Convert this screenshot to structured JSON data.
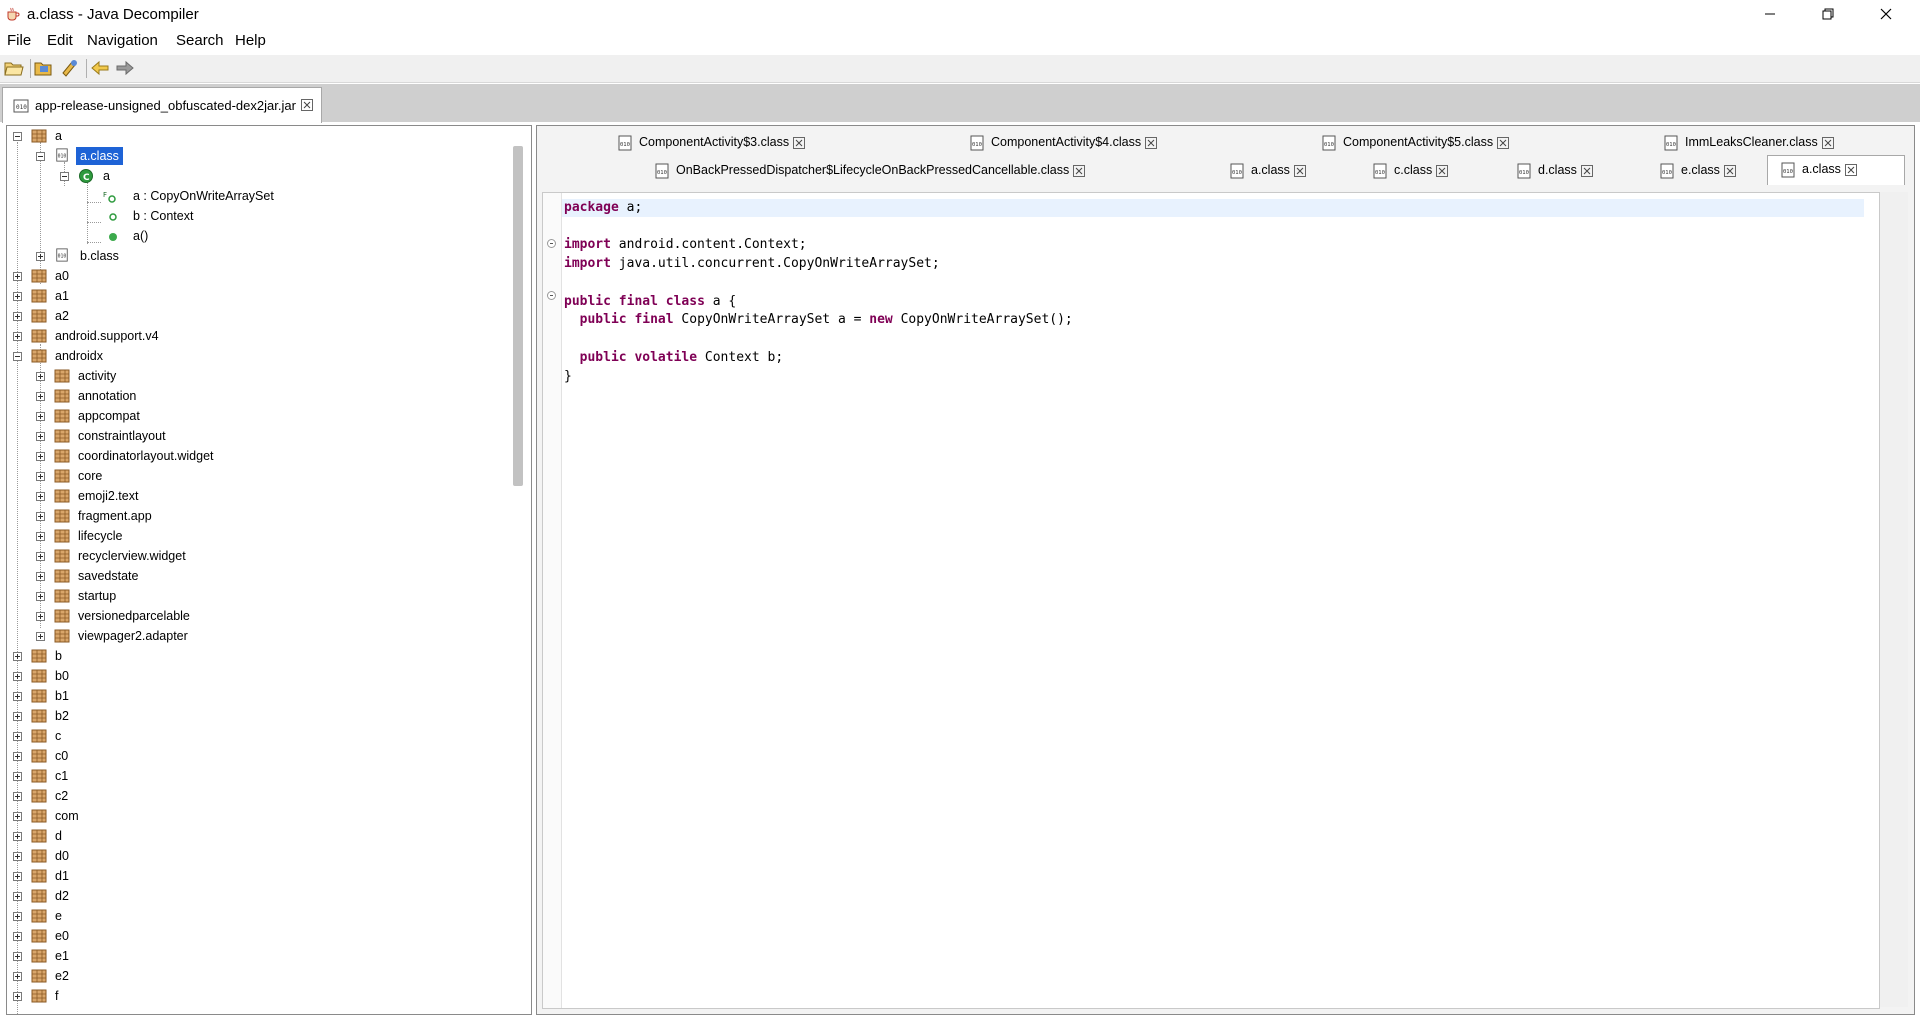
{
  "window": {
    "title": "a.class - Java Decompiler"
  },
  "menu": [
    "File",
    "Edit",
    "Navigation",
    "Search",
    "Help"
  ],
  "toolbar": {
    "icons": [
      "open-file-icon",
      "open-folder-icon",
      "search-type-icon",
      "back-arrow-icon",
      "forward-arrow-icon"
    ]
  },
  "file_tab": {
    "label": "app-release-unsigned_obfuscated-dex2jar.jar"
  },
  "tree": {
    "root_a": "a",
    "a_class": "a.class",
    "class_a": "a",
    "field_a": "a : CopyOnWriteArraySet",
    "field_b": "b : Context",
    "method_a": "a()",
    "b_class": "b.class",
    "packages_top": [
      "a0",
      "a1",
      "a2",
      "android.support.v4",
      "androidx"
    ],
    "androidx_children": [
      "activity",
      "annotation",
      "appcompat",
      "constraintlayout",
      "coordinatorlayout.widget",
      "core",
      "emoji2.text",
      "fragment.app",
      "lifecycle",
      "recyclerview.widget",
      "savedstate",
      "startup",
      "versionedparcelable",
      "viewpager2.adapter"
    ],
    "packages_bottom": [
      "b",
      "b0",
      "b1",
      "b2",
      "c",
      "c0",
      "c1",
      "c2",
      "com",
      "d",
      "d0",
      "d1",
      "d2",
      "e",
      "e0",
      "e1",
      "e2",
      "f"
    ]
  },
  "class_tabs_row1": [
    "ComponentActivity$3.class",
    "ComponentActivity$4.class",
    "ComponentActivity$5.class",
    "ImmLeaksCleaner.class"
  ],
  "class_tabs_row2": [
    "OnBackPressedDispatcher$LifecycleOnBackPressedCancellable.class",
    "a.class",
    "c.class",
    "d.class",
    "e.class",
    "a.class"
  ],
  "code": {
    "line1": [
      "package",
      " a;"
    ],
    "line2": [
      "import",
      " android.content.Context;"
    ],
    "line3": [
      "import",
      " java.util.concurrent.CopyOnWriteArraySet;"
    ],
    "line4": [
      "public",
      " ",
      "final",
      " ",
      "class",
      " a {"
    ],
    "line5": [
      "  ",
      "public",
      " ",
      "final",
      " CopyOnWriteArraySet a = ",
      "new",
      " CopyOnWriteArraySet();"
    ],
    "line6": [
      "  ",
      "public",
      " ",
      "volatile",
      " Context b;"
    ],
    "line7": "}"
  },
  "colors": {
    "keyword": "#7f0055",
    "selection": "#1e63d6",
    "current_line": "#e8f2fe"
  }
}
